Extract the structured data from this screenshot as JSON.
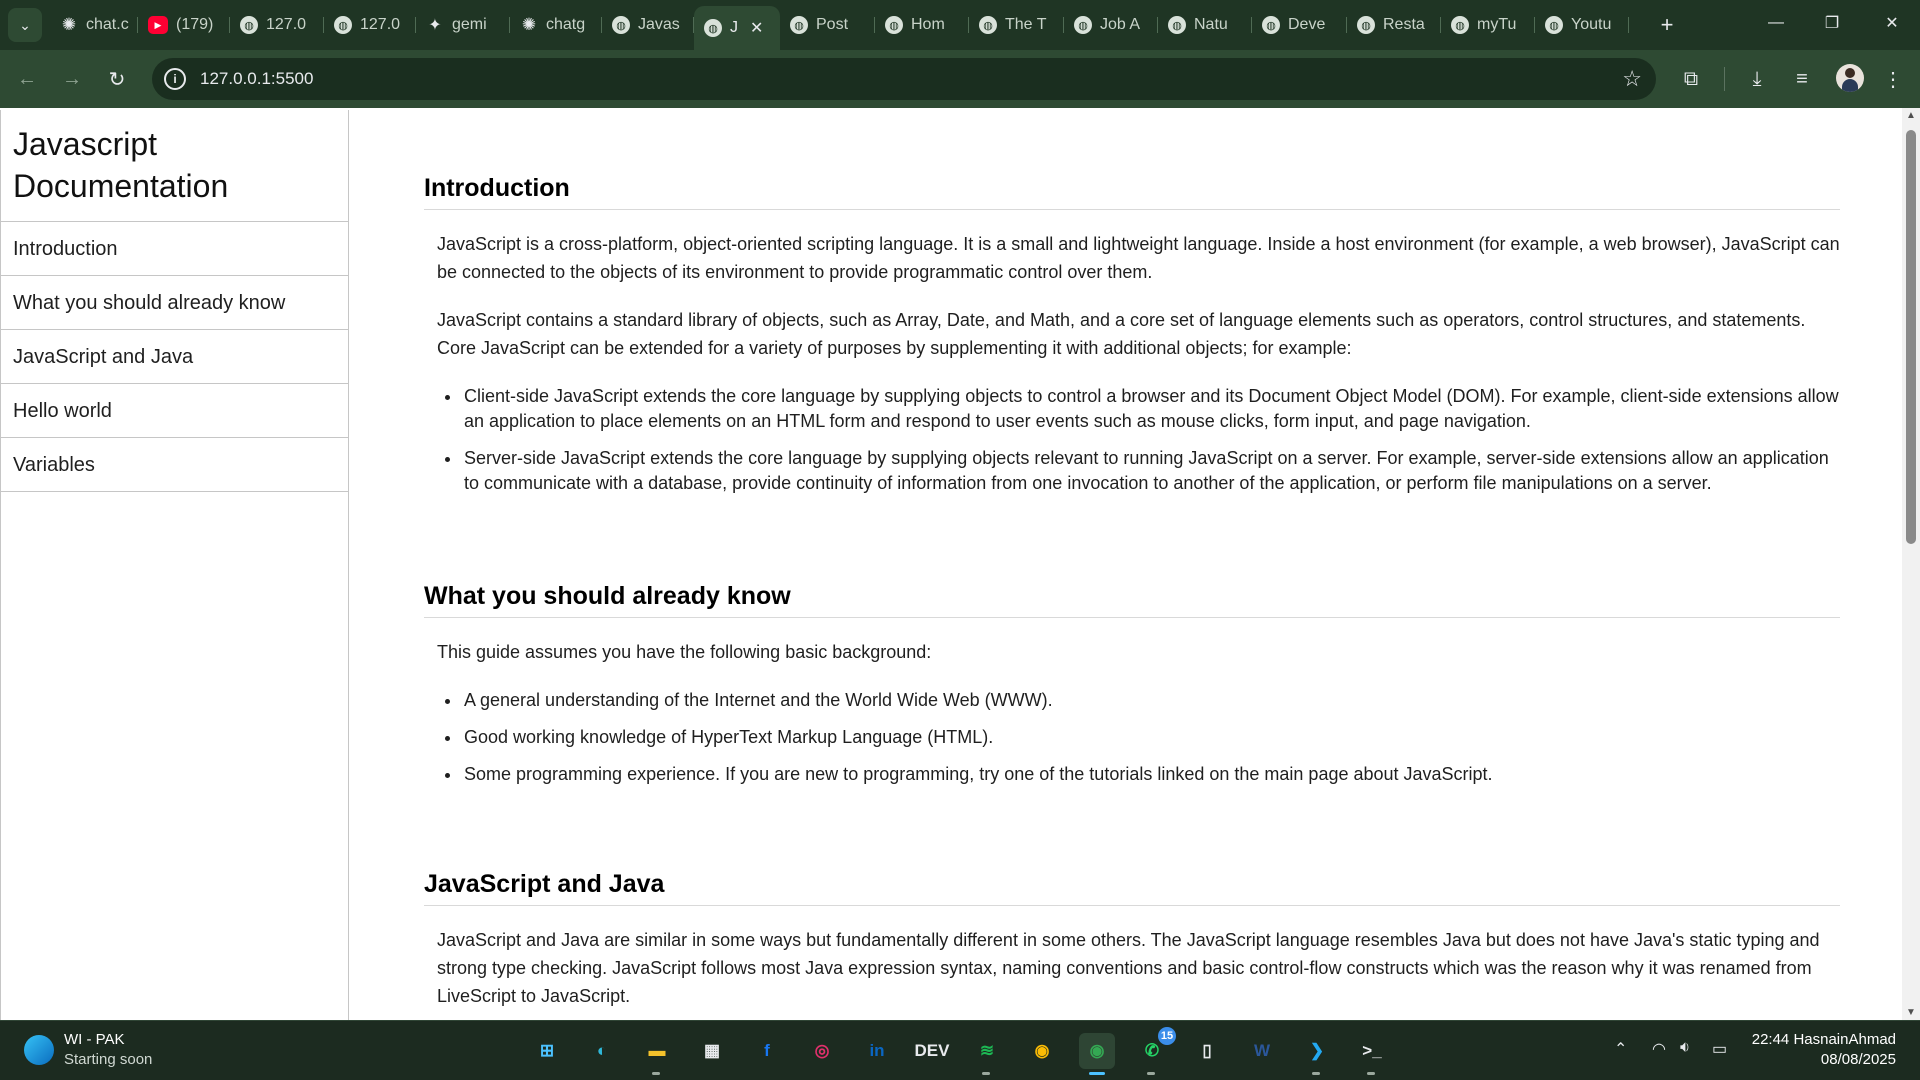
{
  "browser": {
    "tabs": [
      {
        "label": "chat.c",
        "icon": "chatgpt-icon",
        "glyph": "✺"
      },
      {
        "label": "(179)",
        "icon": "youtube-icon",
        "glyph": "▶"
      },
      {
        "label": "127.0",
        "icon": "globe-icon",
        "glyph": "◍"
      },
      {
        "label": "127.0",
        "icon": "globe-icon",
        "glyph": "◍"
      },
      {
        "label": "gemi",
        "icon": "gemini-icon",
        "glyph": "✦"
      },
      {
        "label": "chatg",
        "icon": "chatgpt-icon",
        "glyph": "✺"
      },
      {
        "label": "Javas",
        "icon": "globe-icon",
        "glyph": "◍"
      },
      {
        "label": "J",
        "icon": "globe-icon",
        "glyph": "◍",
        "active": true
      },
      {
        "label": "Post",
        "icon": "globe-icon",
        "glyph": "◍"
      },
      {
        "label": "Hom",
        "icon": "globe-icon",
        "glyph": "◍"
      },
      {
        "label": "The T",
        "icon": "globe-icon",
        "glyph": "◍"
      },
      {
        "label": "Job A",
        "icon": "globe-icon",
        "glyph": "◍"
      },
      {
        "label": "Natu",
        "icon": "globe-icon",
        "glyph": "◍"
      },
      {
        "label": "Deve",
        "icon": "globe-icon",
        "glyph": "◍"
      },
      {
        "label": "Resta",
        "icon": "globe-icon",
        "glyph": "◍"
      },
      {
        "label": "myTu",
        "icon": "globe-icon",
        "glyph": "◍"
      },
      {
        "label": "Youtu",
        "icon": "globe-icon",
        "glyph": "◍"
      }
    ],
    "url": "127.0.0.1:5500",
    "colors": {
      "frame": "#1f3524",
      "toolbar": "#2e4a33",
      "omnibox": "#1a2e1f"
    }
  },
  "page": {
    "nav": {
      "title": "Javascript Documentation",
      "links": [
        "Introduction",
        "What you should already know",
        "JavaScript and Java",
        "Hello world",
        "Variables"
      ]
    },
    "sections": {
      "intro": {
        "heading": "Introduction",
        "p1": "JavaScript is a cross-platform, object-oriented scripting language. It is a small and lightweight language. Inside a host environment (for example, a web browser), JavaScript can be connected to the objects of its environment to provide programmatic control over them.",
        "p2": "JavaScript contains a standard library of objects, such as Array, Date, and Math, and a core set of language elements such as operators, control structures, and statements. Core JavaScript can be extended for a variety of purposes by supplementing it with additional objects; for example:",
        "items": [
          "Client-side JavaScript extends the core language by supplying objects to control a browser and its Document Object Model (DOM). For example, client-side extensions allow an application to place elements on an HTML form and respond to user events such as mouse clicks, form input, and page navigation.",
          "Server-side JavaScript extends the core language by supplying objects relevant to running JavaScript on a server. For example, server-side extensions allow an application to communicate with a database, provide continuity of information from one invocation to another of the application, or perform file manipulations on a server."
        ]
      },
      "know": {
        "heading": "What you should already know",
        "p1": "This guide assumes you have the following basic background:",
        "items": [
          "A general understanding of the Internet and the World Wide Web (WWW).",
          "Good working knowledge of HyperText Markup Language (HTML).",
          "Some programming experience. If you are new to programming, try one of the tutorials linked on the main page about JavaScript."
        ]
      },
      "java": {
        "heading": "JavaScript and Java",
        "p1": "JavaScript and Java are similar in some ways but fundamentally different in some others. The JavaScript language resembles Java but does not have Java's static typing and strong type checking. JavaScript follows most Java expression syntax, naming conventions and basic control-flow constructs which was the reason why it was renamed from LiveScript to JavaScript."
      }
    }
  },
  "taskbar": {
    "weather_title": "WI - PAK",
    "weather_sub": "Starting soon",
    "apps": [
      {
        "name": "start-button",
        "glyph": "⊞",
        "color": "#4cc2ff"
      },
      {
        "name": "edge-app",
        "glyph": "◐",
        "color": "#2fb8d9"
      },
      {
        "name": "file-explorer-app",
        "glyph": "▬",
        "color": "#f4c22b",
        "running": true
      },
      {
        "name": "store-app",
        "glyph": "▦",
        "color": "#e8eaed"
      },
      {
        "name": "facebook-app",
        "glyph": "f",
        "color": "#1877f2"
      },
      {
        "name": "instagram-app",
        "glyph": "◎",
        "color": "#e1306c"
      },
      {
        "name": "linkedin-app",
        "glyph": "in",
        "color": "#0a66c2"
      },
      {
        "name": "dev-app",
        "glyph": "DEV",
        "color": "#e8eaed"
      },
      {
        "name": "spotify-app",
        "glyph": "≋",
        "color": "#1db954",
        "running": true
      },
      {
        "name": "chrome-app",
        "glyph": "◉",
        "color": "#fbbc05"
      },
      {
        "name": "chrome-profile-app",
        "glyph": "◉",
        "color": "#34a853",
        "active": true,
        "running": true
      },
      {
        "name": "whatsapp-app",
        "glyph": "✆",
        "color": "#25d366",
        "badge": "15",
        "running": true
      },
      {
        "name": "notepad-app",
        "glyph": "▯",
        "color": "#e8eaed"
      },
      {
        "name": "word-app",
        "glyph": "W",
        "color": "#2b579a"
      },
      {
        "name": "vscode-app",
        "glyph": "❯",
        "color": "#23a9f2",
        "running": true
      },
      {
        "name": "terminal-app",
        "glyph": ">_",
        "color": "#e8eaed",
        "running": true
      }
    ],
    "time": "22:44 HasnainAhmad",
    "date": "08/08/2025"
  }
}
